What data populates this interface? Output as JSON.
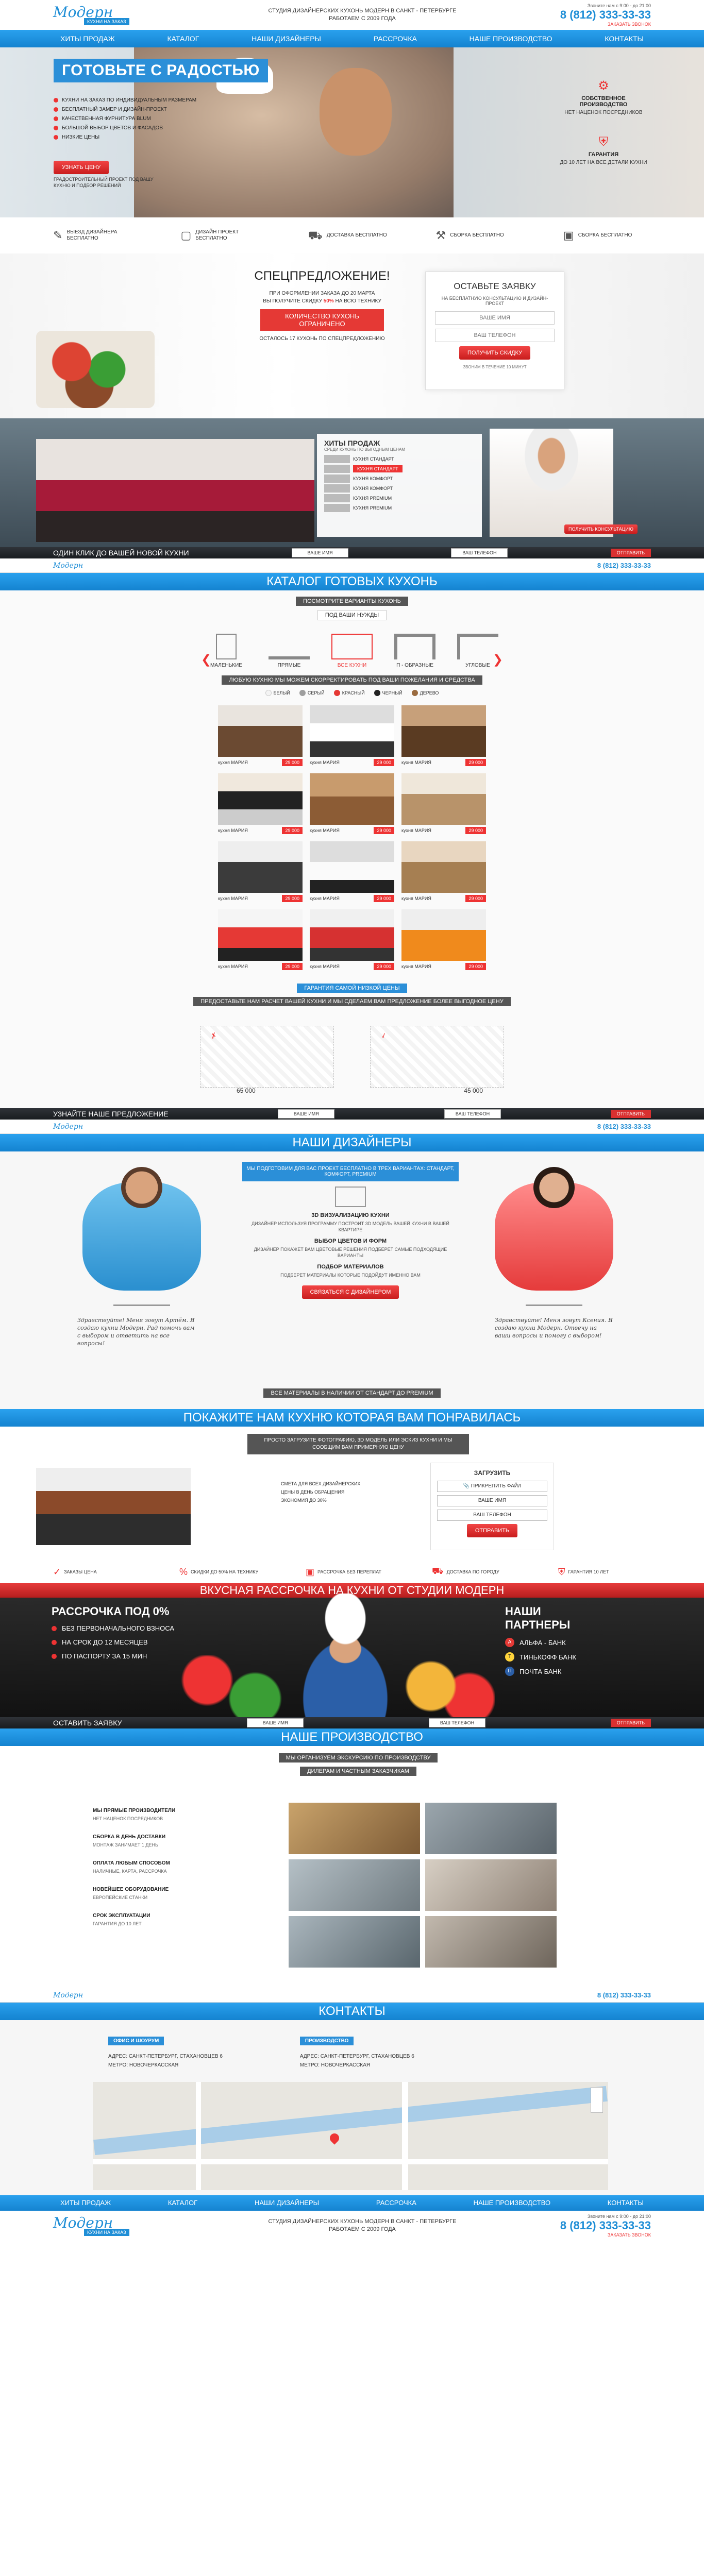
{
  "header": {
    "logo": "Модерн",
    "logo_badge": "КУХНИ НА ЗАКАЗ",
    "city": "САНКТ-ПЕТЕРБУРГ",
    "tagline": "СТУДИЯ ДИЗАЙНЕРСКИХ КУХОНЬ МОДЕРН В САНКТ - ПЕТЕРБУРГЕ",
    "tagline2": "РАБОТАЕМ С 2009 ГОДА",
    "hours": "Звоните нам с 9:00 - до 21:00",
    "phone": "8 (812) 333-33-33",
    "callback": "ЗАКАЗАТЬ ЗВОНОК"
  },
  "nav": [
    "ХИТЫ ПРОДАЖ",
    "КАТАЛОГ",
    "НАШИ ДИЗАЙНЕРЫ",
    "РАССРОЧКА",
    "НАШЕ ПРОИЗВОДСТВО",
    "КОНТАКТЫ"
  ],
  "hero": {
    "title": "ГОТОВЬТЕ С РАДОСТЬЮ",
    "bullets": [
      "КУХНИ НА ЗАКАЗ ПО ИНДИВИДУАЛЬНЫМ РАЗМЕРАМ",
      "БЕСПЛАТНЫЙ ЗАМЕР И ДИЗАЙН-ПРОЕКТ",
      "КАЧЕСТВЕННАЯ ФУРНИТУРА BLUM",
      "БОЛЬШОЙ ВЫБОР ЦВЕТОВ И ФАСАДОВ",
      "НИЗКИЕ ЦЕНЫ"
    ],
    "cta": "УЗНАТЬ ЦЕНУ",
    "note": "ГРАДОСТРОИТЕЛЬНЫЙ ПРОЕКТ ПОД ВАШУ КУХНЮ И ПОДБОР РЕШЕНИЙ"
  },
  "side_blocks": [
    {
      "title": "СОБСТВЕННОЕ ПРОИЗВОДСТВО",
      "text": "НЕТ НАЦЕНОК ПОСРЕДНИКОВ"
    },
    {
      "title": "ГАРАНТИЯ",
      "text": "ДО 10 ЛЕТ НА ВСЕ ДЕТАЛИ КУХНИ"
    }
  ],
  "features": [
    {
      "icon": "ruler-icon",
      "text": "ВЫЕЗД ДИЗАЙНЕРА БЕСПЛАТНО"
    },
    {
      "icon": "sketch-icon",
      "text": "ДИЗАЙН ПРОЕКТ БЕСПЛАТНО"
    },
    {
      "icon": "truck-icon",
      "text": "ДОСТАВКА БЕСПЛАТНО"
    },
    {
      "icon": "tools-icon",
      "text": "СБОРКА БЕСПЛАТНО"
    },
    {
      "icon": "wallet-icon",
      "text": "СБОРКА БЕСПЛАТНО"
    }
  ],
  "offer": {
    "title": "СПЕЦПРЕДЛОЖЕНИЕ!",
    "line1": "ПРИ ОФОРМЛЕНИИ ЗАКАЗА ДО 20 МАРТА",
    "line2": "ВЫ ПОЛУЧИТЕ СКИДКУ",
    "discount": "50%",
    "line3": "НА ВСЮ ТЕХНИКУ",
    "badge": "КОЛИЧЕСТВО КУХОНЬ ОГРАНИЧЕНО",
    "remaining": "ОСТАЛОСЬ 17 КУХОНЬ ПО СПЕЦПРЕДЛОЖЕНИЮ"
  },
  "order_form": {
    "title": "ОСТАВЬТЕ ЗАЯВКУ",
    "sub": "НА БЕСПЛАТНУЮ КОНСУЛЬТАЦИЮ И ДИЗАЙН-ПРОЕКТ",
    "name_placeholder": "ВАШЕ ИМЯ",
    "phone_placeholder": "ВАШ ТЕЛЕФОН",
    "submit": "ПОЛУЧИТЬ СКИДКУ",
    "note": "ЗВОНИМ В ТЕЧЕНИЕ 10 МИНУТ"
  },
  "hits": {
    "title": "ХИТЫ ПРОДАЖ",
    "sub": "СРЕДИ КУХОНЬ ПО ВЫГОДНЫМ ЦЕНАМ",
    "items": [
      "КУХНЯ СТАНДАРТ",
      "КУХНЯ СТАНДАРТ",
      "КУХНЯ КОМФОРТ",
      "КУХНЯ КОМФОРТ",
      "КУХНЯ PREMIUM",
      "КУХНЯ PREMIUM"
    ],
    "cta": "ПОЛУЧИТЬ КОНСУЛЬТАЦИЮ",
    "bar_title": "ОДИН КЛИК ДО ВАШЕЙ НОВОЙ КУХНИ",
    "bar_name": "ВАШЕ ИМЯ",
    "bar_phone": "ВАШ ТЕЛЕФОН",
    "bar_btn": "ОТПРАВИТЬ"
  },
  "catalog": {
    "title": "КАТАЛОГ ГОТОВЫХ КУХОНЬ",
    "step1": "ПОСМОТРИТЕ ВАРИАНТЫ КУХОНЬ",
    "step2": "ПОД ВАШИ НУЖДЫ",
    "shapes": [
      "МАЛЕНЬКИЕ",
      "ПРЯМЫЕ",
      "ВСЕ КУХНИ",
      "П - ОБРАЗНЫЕ",
      "УГЛОВЫЕ"
    ],
    "colors_title": "ЛЮБУЮ КУХНЮ МЫ МОЖЕМ СКОРРЕКТИРОВАТЬ ПОД ВАШИ ПОЖЕЛАНИЯ И СРЕДСТВА",
    "colors": [
      {
        "name": "БЕЛЫЙ",
        "color": "#f4f4f4"
      },
      {
        "name": "СЕРЫЙ",
        "color": "#9e9e9e"
      },
      {
        "name": "КРАСНЫЙ",
        "color": "#e53935"
      },
      {
        "name": "ЧЕРНЫЙ",
        "color": "#222222"
      },
      {
        "name": "ДЕРЕВО",
        "color": "#9a6b3f"
      }
    ],
    "kitchens": [
      {
        "name": "кухня МАРИЯ",
        "price": "29 000"
      },
      {
        "name": "кухня МАРИЯ",
        "price": "29 000"
      },
      {
        "name": "кухня МАРИЯ",
        "price": "29 000"
      },
      {
        "name": "кухня МАРИЯ",
        "price": "29 000"
      },
      {
        "name": "кухня МАРИЯ",
        "price": "29 000"
      },
      {
        "name": "кухня МАРИЯ",
        "price": "29 000"
      },
      {
        "name": "кухня МАРИЯ",
        "price": "29 000"
      },
      {
        "name": "кухня МАРИЯ",
        "price": "29 000"
      },
      {
        "name": "кухня МАРИЯ",
        "price": "29 000"
      },
      {
        "name": "кухня МАРИЯ",
        "price": "29 000"
      },
      {
        "name": "кухня МАРИЯ",
        "price": "29 000"
      },
      {
        "name": "кухня МАРИЯ",
        "price": "29 000"
      }
    ],
    "guarantee": "ГАРАНТИЯ САМОЙ НИЗКОЙ ЦЕНЫ",
    "guarantee_sub": "ПРЕДОСТАВЬТЕ НАМ РАСЧЕТ ВАШЕЙ КУХНИ И МЫ СДЕЛАЕМ ВАМ ПРЕДЛОЖЕНИЕ БОЛЕЕ ВЫГОДНОЕ ЦЕНУ",
    "price_a": "65 000",
    "price_b": "45 000",
    "bar_title": "УЗНАЙТЕ НАШЕ ПРЕДЛОЖЕНИЕ"
  },
  "designers": {
    "title": "НАШИ ДИЗАЙНЕРЫ",
    "box": "МЫ ПОДГОТОВИМ ДЛЯ ВАС ПРОЕКТ БЕСПЛАТНО В ТРЕХ ВАРИАНТАХ: СТАНДАРТ, КОМФОРТ, PREMIUM",
    "h1": "3D ВИЗУАЛИЗАЦИЮ КУХНИ",
    "p1": "ДИЗАЙНЕР ИСПОЛЬЗУЯ ПРОГРАММУ ПОСТРОИТ 3D МОДЕЛЬ ВАШЕЙ КУХНИ В ВАШЕЙ КВАРТИРЕ",
    "h2": "ВЫБОР ЦВЕТОВ И ФОРМ",
    "p2": "ДИЗАЙНЕР ПОКАЖЕТ ВАМ ЦВЕТОВЫЕ РЕШЕНИЯ ПОДБЕРЕТ САМЫЕ ПОДХОДЯЩИЕ ВАРИАНТЫ",
    "h3": "ПОДБОР МАТЕРИАЛОВ",
    "p3": "ПОДБЕРЕТ МАТЕРИАЛЫ КОТОРЫЕ ПОДОЙДУТ ИМЕННО ВАМ",
    "cta": "СВЯЗАТЬСЯ С ДИЗАЙНЕРОМ",
    "quote1": "Здравствуйте! Меня зовут Артём. Я создаю кухни Модерн. Рад помочь вам с выбором и ответить на все вопросы!",
    "quote2": "Здравствуйте! Меня зовут Ксения. Я создаю кухни Модерн. Отвечу на ваши вопросы и помогу с выбором!",
    "stock": "ВСЕ МАТЕРИАЛЫ В НАЛИЧИИ ОТ СТАНДАРТ ДО PREMIUM"
  },
  "upload": {
    "title": "ПОКАЖИТЕ НАМ КУХНЮ КОТОРАЯ ВАМ ПОНРАВИЛАСЬ",
    "box": "ПРОСТО ЗАГРУЗИТЕ ФОТОГРАФИЮ, 3D МОДЕЛЬ ИЛИ ЭСКИЗ КУХНИ И МЫ СООБЩИМ ВАМ ПРИМЕРНУЮ ЦЕНУ",
    "list": [
      "СМЕТА ДЛЯ ВСЕХ ДИЗАЙНЕРСКИХ",
      "ЦЕНЫ В ДЕНЬ ОБРАЩЕНИЯ",
      "ЭКОНОМИЯ ДО 30%"
    ],
    "form_title": "ЗАГРУЗИТЬ",
    "file": "ПРИКРЕПИТЬ ФАЙЛ",
    "name": "ВАШЕ ИМЯ",
    "phone": "ВАШ ТЕЛЕФОН",
    "submit": "ОТПРАВИТЬ",
    "ticks": [
      "ЗАКАЗЫ ЦЕНА",
      "СКИДКИ ДО 50% НА ТЕХНИКУ",
      "РАССРОЧКА БЕЗ ПЕРЕПЛАТ",
      "ДОСТАВКА ПО ГОРОДУ",
      "ГАРАНТИЯ 10 ЛЕТ"
    ]
  },
  "credit": {
    "banner": "ВКУСНАЯ РАССРОЧКА НА КУХНИ ОТ СТУДИИ МОДЕРН",
    "title": "РАССРОЧКА ПОД 0%",
    "items": [
      "БЕЗ ПЕРВОНАЧАЛЬНОГО ВЗНОСА",
      "НА СРОК ДО 12 МЕСЯЦЕВ",
      "ПО ПАСПОРТУ ЗА 15 МИН"
    ],
    "partners_title": "НАШИ ПАРТНЕРЫ",
    "partners": [
      {
        "name": "АЛЬФА - БАНК",
        "color": "#e53935"
      },
      {
        "name": "ТИНЬКОФФ БАНК",
        "color": "#ffd43b"
      },
      {
        "name": "ПОЧТА БАНК",
        "color": "#2b5fa8"
      }
    ],
    "bar_title": "ОСТАВИТЬ ЗАЯВКУ"
  },
  "production": {
    "title": "НАШЕ ПРОИЗВОДСТВО",
    "box1": "МЫ ОРГАНИЗУЕМ ЭКСКУРСИЮ ПО ПРОИЗВОДСТВУ",
    "box2": "ДИЛЕРАМ И ЧАСТНЫМ ЗАКАЗЧИКАМ",
    "items": [
      {
        "t": "МЫ ПРЯМЫЕ ПРОИЗВОДИТЕЛИ",
        "s": "НЕТ НАЦЕНОК ПОСРЕДНИКОВ"
      },
      {
        "t": "СБОРКА В ДЕНЬ ДОСТАВКИ",
        "s": "МОНТАЖ ЗАНИМАЕТ 1 ДЕНЬ"
      },
      {
        "t": "ОПЛАТА ЛЮБЫМ СПОСОБОМ",
        "s": "НАЛИЧНЫЕ, КАРТА, РАССРОЧКА"
      },
      {
        "t": "НОВЕЙШЕЕ ОБОРУДОВАНИЕ",
        "s": "ЕВРОПЕЙСКИЕ СТАНКИ"
      },
      {
        "t": "СРОК ЭКСПЛУАТАЦИИ",
        "s": "ГАРАНТИЯ ДО 10 ЛЕТ"
      }
    ]
  },
  "contacts": {
    "title": "КОНТАКТЫ",
    "office_label": "ОФИС И ШОУРУМ",
    "office_addr": "АДРЕС: САНКТ-ПЕТЕРБУРГ, СТАХАНОВЦЕВ 6",
    "office_metro": "МЕТРО: НОВОЧЕРКАССКАЯ",
    "factory_label": "ПРОИЗВОДСТВО",
    "factory_addr": "АДРЕС: САНКТ-ПЕТЕРБУРГ, СТАХАНОВЦЕВ 6",
    "factory_metro": "МЕТРО: НОВОЧЕРКАССКАЯ"
  }
}
